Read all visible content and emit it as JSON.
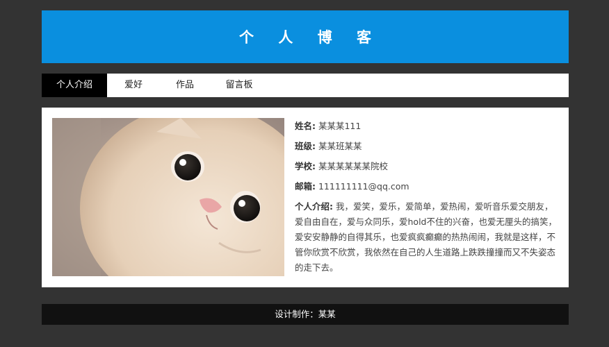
{
  "header": {
    "title": "个 人 博 客"
  },
  "nav": {
    "items": [
      {
        "label": "个人介绍",
        "active": true
      },
      {
        "label": "爱好",
        "active": false
      },
      {
        "label": "作品",
        "active": false
      },
      {
        "label": "留言板",
        "active": false
      }
    ]
  },
  "profile": {
    "photo_alt": "cat-photo",
    "fields": [
      {
        "key": "姓名:",
        "value": "某某某111"
      },
      {
        "key": "班级:",
        "value": "某某班某某"
      },
      {
        "key": "学校:",
        "value": "某某某某某某院校"
      },
      {
        "key": "邮箱:",
        "value": "111111111@qq.com"
      }
    ],
    "bio_label": "个人介绍:",
    "bio_text": "我，爱笑，爱乐，爱简单，爱热闹，爱听音乐爱交朋友，爱自由自在，爱与众同乐，爱hold不住的兴奋，也爱无厘头的搞笑，爱安安静静的自得其乐，也爱疯疯癫癫的热热闹闹，我就是这样，不管你欣赏不欣赏，我依然在自己的人生道路上跌跌撞撞而又不失姿态的走下去。"
  },
  "footer": {
    "text": "设计制作：某某"
  },
  "colors": {
    "page_bg": "#333333",
    "header_bg": "#0a8fdf",
    "nav_active_bg": "#000000",
    "footer_bg": "#111111"
  }
}
